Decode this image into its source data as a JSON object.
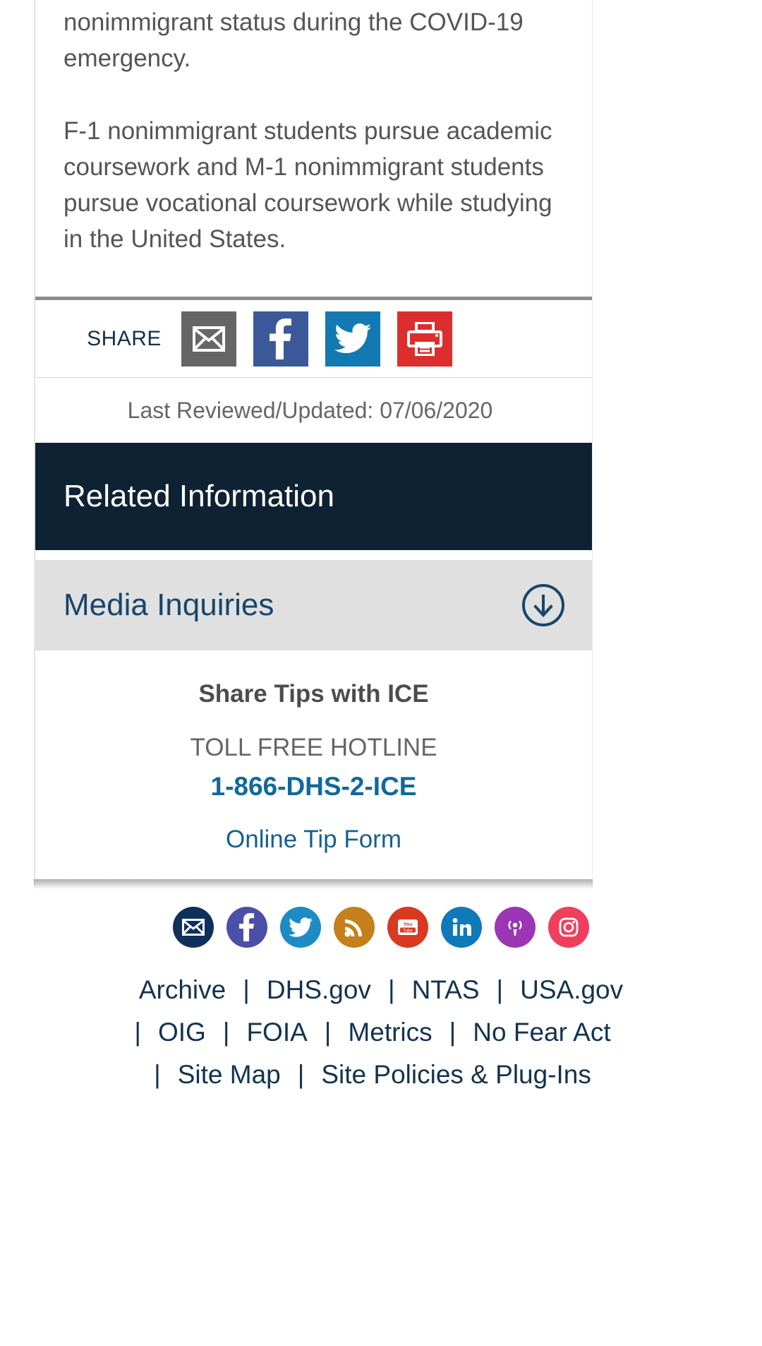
{
  "article": {
    "paragraph_1": "nonimmigrant status during the COVID-19 emergency.",
    "paragraph_2": "F-1 nonimmigrant students pursue academic coursework and M-1 nonimmigrant students pursue vocational coursework while studying in the United States."
  },
  "share": {
    "label": "SHARE",
    "buttons": [
      {
        "name": "email-share",
        "icon": "envelope-icon",
        "color": "#666666"
      },
      {
        "name": "facebook-share",
        "icon": "facebook-icon",
        "color": "#3b5998"
      },
      {
        "name": "twitter-share",
        "icon": "twitter-icon",
        "color": "#1279b3"
      },
      {
        "name": "print-page",
        "icon": "printer-icon",
        "color": "#dd2e2e"
      }
    ]
  },
  "meta": {
    "last_reviewed": "Last Reviewed/Updated: 07/06/2020"
  },
  "related": {
    "banner_title": "Related Information",
    "accordion": {
      "title": "Media Inquiries",
      "arrow_icon": "circle-arrow-down-icon",
      "expanded": false
    }
  },
  "tips": {
    "title": "Share Tips with ICE",
    "hotline_label": "TOLL FREE HOTLINE",
    "hotline_number": "1-866-DHS-2-ICE",
    "tip_form_link": "Online Tip Form"
  },
  "footer": {
    "social": [
      {
        "name": "email-icon",
        "label": "Email",
        "color": "#10305c"
      },
      {
        "name": "facebook-icon",
        "label": "Facebook",
        "color": "#4b4fa8"
      },
      {
        "name": "twitter-icon",
        "label": "Twitter",
        "color": "#1d8cc4"
      },
      {
        "name": "rss-icon",
        "label": "RSS",
        "color": "#c3801b"
      },
      {
        "name": "youtube-icon",
        "label": "YouTube",
        "color": "#d8391f"
      },
      {
        "name": "linkedin-icon",
        "label": "LinkedIn",
        "color": "#1079b8"
      },
      {
        "name": "podcast-icon",
        "label": "Podcast",
        "color": "#9b36b5"
      },
      {
        "name": "instagram-icon",
        "label": "Instagram",
        "color": "#ef3f5e"
      }
    ],
    "links_row_1": [
      "Archive",
      "DHS.gov",
      "NTAS",
      "USA.gov"
    ],
    "links_row_2": [
      "OIG",
      "FOIA",
      "Metrics",
      "No Fear Act"
    ],
    "links_row_3": [
      "Site Map",
      "Site Policies & Plug-Ins"
    ],
    "separator": "|"
  },
  "colors": {
    "banner_navy": "#0e2233",
    "accordion_grey": "#e0e0e0",
    "link_blue": "#18456b",
    "hotline_blue": "#10699c",
    "body_text": "#555555"
  }
}
